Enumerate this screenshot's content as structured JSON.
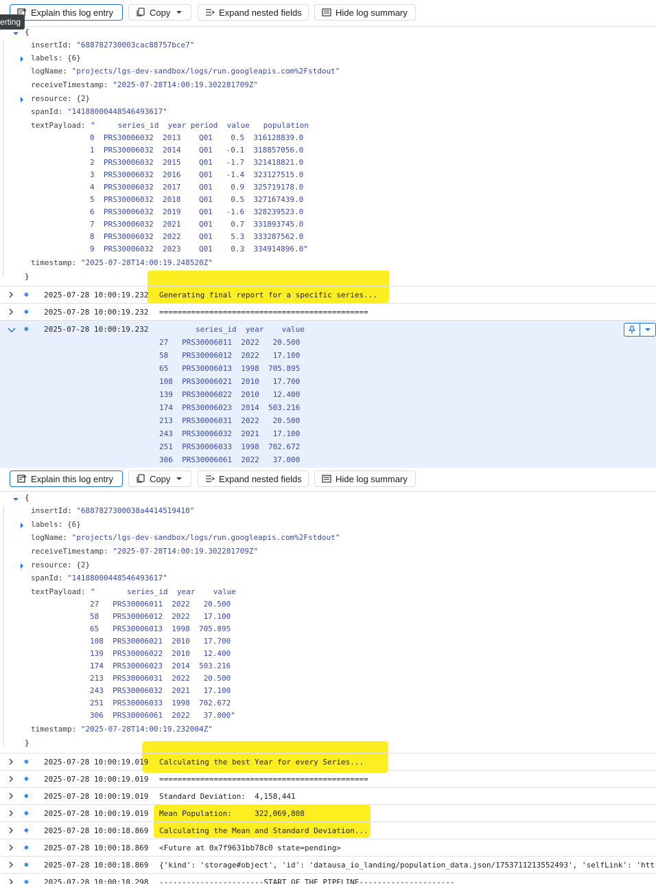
{
  "toolbar": {
    "explain_label": "Explain this log entry",
    "copy_label": "Copy",
    "expand_label": "Expand nested fields",
    "hide_label": "Hide log summary"
  },
  "tooltip": "erting",
  "entry1": {
    "open_brace": "{",
    "close_brace": "}",
    "insertId_key": "insertId",
    "insertId": "\"688782730003cac88757bce7\"",
    "labels_key": "labels",
    "labels": "{6}",
    "logName_key": "logName",
    "logName": "\"projects/lgs-dev-sandbox/logs/run.googleapis.com%2Fstdout\"",
    "receiveTimestamp_key": "receiveTimestamp",
    "receiveTimestamp": "\"2025-07-28T14:00:19.302281709Z\"",
    "resource_key": "resource",
    "resource": "{2}",
    "spanId_key": "spanId",
    "spanId": "\"14188000448546493617\"",
    "textPayload_key": "textPayload",
    "textPayload_lines": [
      "\"     series_id  year period  value   population",
      "0  PRS30006032  2013    Q01    0.5  316128839.0",
      "1  PRS30006032  2014    Q01   -0.1  318857056.0",
      "2  PRS30006032  2015    Q01   -1.7  321418821.0",
      "3  PRS30006032  2016    Q01   -1.4  323127515.0",
      "4  PRS30006032  2017    Q01    0.9  325719178.0",
      "5  PRS30006032  2018    Q01    0.5  327167439.0",
      "6  PRS30006032  2019    Q01   -1.6  328239523.0",
      "7  PRS30006032  2021    Q01    0.7  331893745.0",
      "8  PRS30006032  2022    Q01    5.3  333287562.0",
      "9  PRS30006032  2023    Q01    0.3  334914896.0\""
    ],
    "timestamp_key": "timestamp",
    "timestamp": "\"2025-07-28T14:00:19.248520Z\""
  },
  "rows_a": [
    {
      "ts": "2025-07-28 10:00:19.232",
      "msg": "Generating final report for a specific series..."
    },
    {
      "ts": "2025-07-28 10:00:19.232",
      "msg": "=============================================="
    }
  ],
  "expanded_row": {
    "ts": "2025-07-28 10:00:19.232",
    "lines": [
      "        series_id  year    value",
      "27   PRS30006011  2022   20.500",
      "58   PRS30006012  2022   17.100",
      "65   PRS30006013  1998  705.895",
      "108  PRS30006021  2010   17.700",
      "139  PRS30006022  2010   12.400",
      "174  PRS30006023  2014  503.216",
      "213  PRS30006031  2022   20.500",
      "243  PRS30006032  2021   17.100",
      "251  PRS30006033  1998  702.672",
      "306  PRS30006061  2022   37.000"
    ]
  },
  "entry2": {
    "open_brace": "{",
    "close_brace": "}",
    "insertId_key": "insertId",
    "insertId": "\"6887827300038a4414519410\"",
    "labels_key": "labels",
    "labels": "{6}",
    "logName_key": "logName",
    "logName": "\"projects/lgs-dev-sandbox/logs/run.googleapis.com%2Fstdout\"",
    "receiveTimestamp_key": "receiveTimestamp",
    "receiveTimestamp": "\"2025-07-28T14:00:19.302281709Z\"",
    "resource_key": "resource",
    "resource": "{2}",
    "spanId_key": "spanId",
    "spanId": "\"14188000448546493617\"",
    "textPayload_key": "textPayload",
    "textPayload_lines": [
      "\"       series_id  year    value",
      "27   PRS30006011  2022   20.500",
      "58   PRS30006012  2022   17.100",
      "65   PRS30006013  1998  705.895",
      "108  PRS30006021  2010   17.700",
      "139  PRS30006022  2010   12.400",
      "174  PRS30006023  2014  503.216",
      "213  PRS30006031  2022   20.500",
      "243  PRS30006032  2021   17.100",
      "251  PRS30006033  1998  702.672",
      "306  PRS30006061  2022   37.000\""
    ],
    "timestamp_key": "timestamp",
    "timestamp": "\"2025-07-28T14:00:19.232004Z\""
  },
  "rows_b": [
    {
      "ts": "2025-07-28 10:00:19.019",
      "msg": "Calculating the best Year for every Series..."
    },
    {
      "ts": "2025-07-28 10:00:19.019",
      "msg": "=============================================="
    },
    {
      "ts": "2025-07-28 10:00:19.019",
      "msg": "Standard Deviation:  4,158,441"
    },
    {
      "ts": "2025-07-28 10:00:19.019",
      "msg": "Mean Population:     322,069,808"
    },
    {
      "ts": "2025-07-28 10:00:18.869",
      "msg": "Calculating the Mean and Standard Deviation..."
    },
    {
      "ts": "2025-07-28 10:00:18.869",
      "msg": "<Future at 0x7f9631bb78c0 state=pending>"
    },
    {
      "ts": "2025-07-28 10:00:18.869",
      "msg": "{'kind': 'storage#object', 'id': 'datausa_io_landing/population_data.json/1753711213552493', 'selfLink': 'htt"
    },
    {
      "ts": "2025-07-28 10:00:18.298",
      "msg": "-----------------------START OF THE PIPELINE---------------------"
    }
  ],
  "colors": {
    "highlight": "#fdee21",
    "accent": "#1a73e8",
    "expanded_bg": "#e8f0fe"
  }
}
